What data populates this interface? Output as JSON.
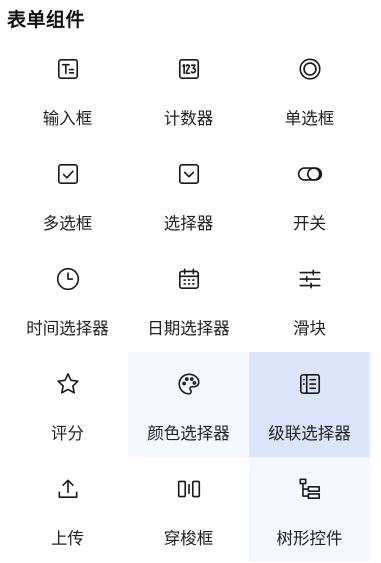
{
  "section": {
    "title": "表单组件"
  },
  "tiles": [
    {
      "label": "输入框",
      "icon": "text-input-icon"
    },
    {
      "label": "计数器",
      "icon": "counter-icon"
    },
    {
      "label": "单选框",
      "icon": "radio-icon"
    },
    {
      "label": "多选框",
      "icon": "checkbox-icon"
    },
    {
      "label": "选择器",
      "icon": "select-icon"
    },
    {
      "label": "开关",
      "icon": "switch-icon"
    },
    {
      "label": "时间选择器",
      "icon": "clock-icon"
    },
    {
      "label": "日期选择器",
      "icon": "calendar-icon"
    },
    {
      "label": "滑块",
      "icon": "slider-icon"
    },
    {
      "label": "评分",
      "icon": "star-icon"
    },
    {
      "label": "颜色选择器",
      "icon": "palette-icon"
    },
    {
      "label": "级联选择器",
      "icon": "cascader-icon"
    },
    {
      "label": "上传",
      "icon": "upload-icon"
    },
    {
      "label": "穿梭框",
      "icon": "transfer-icon"
    },
    {
      "label": "树形控件",
      "icon": "tree-icon"
    }
  ],
  "state": {
    "active_tile": "级联选择器",
    "hover_tiles": [
      "颜色选择器",
      "树形控件"
    ]
  },
  "colors": {
    "active_bg": "#dbe6fc",
    "hover_bg": "#f5f8fe",
    "icon_stroke": "#1a1a1a"
  }
}
